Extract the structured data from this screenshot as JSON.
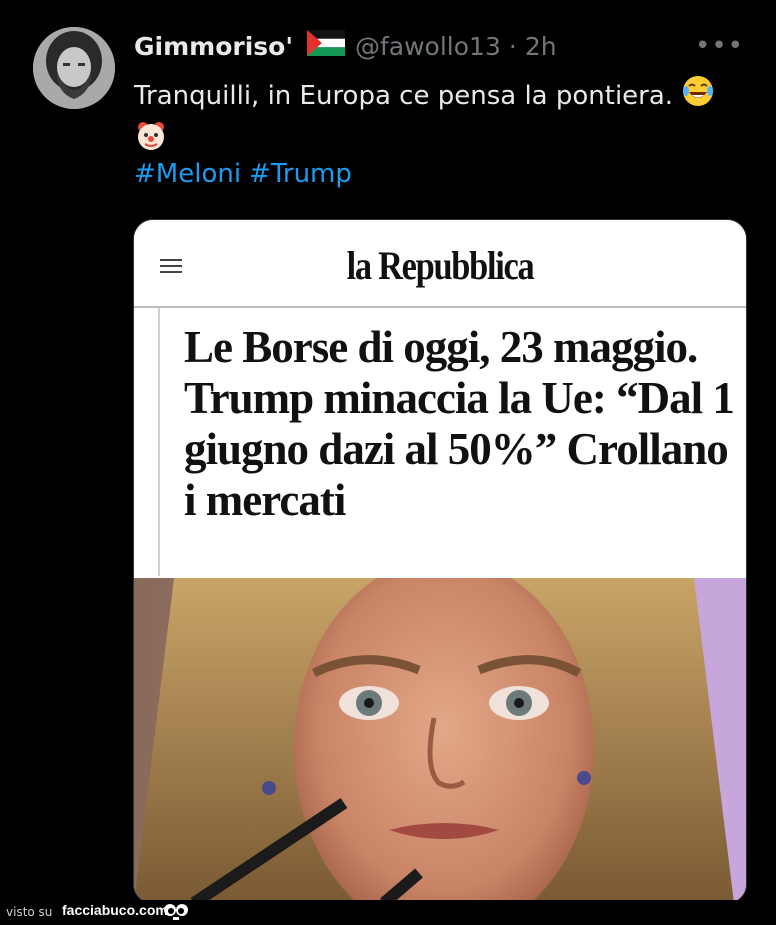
{
  "tweet": {
    "display_name": "Gimmoriso'",
    "handle": "@fawollo13",
    "separator": "·",
    "time": "2h",
    "more_label": "•••",
    "text": "Tranquilli, in Europa ce pensa la pontiera.",
    "emojis": [
      "face-with-tears-of-joy-icon",
      "clown-face-icon"
    ],
    "hashtags": [
      "#Meloni",
      "#Trump"
    ]
  },
  "card": {
    "masthead": "la Repubblica",
    "headline": "Le Borse di oggi, 23 maggio. Trump minaccia la Ue: “Dal 1 giugno dazi al 50%” Crollano i mercati"
  },
  "footer": {
    "visto_su": "visto su",
    "site": "facciabuco.com"
  },
  "colors": {
    "background": "#000000",
    "text": "#e7e9ea",
    "muted": "#71767b",
    "link": "#1d9bf0"
  }
}
